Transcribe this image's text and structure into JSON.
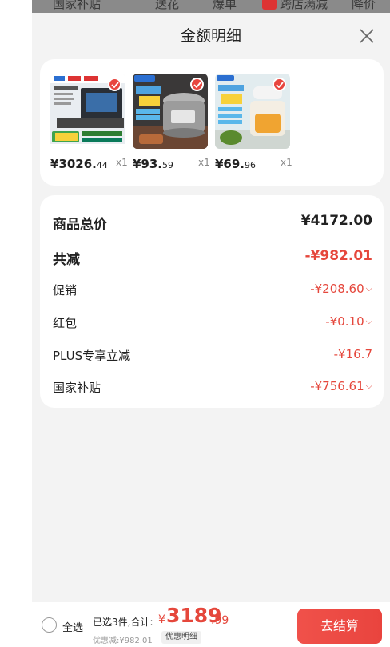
{
  "background_tabs": [
    "国家补贴",
    "送花",
    "爆单",
    "跨店满减",
    "降价"
  ],
  "sheet": {
    "title": "金额明细",
    "close_icon": "close-icon"
  },
  "products": [
    {
      "price_main": "¥3026.",
      "price_dec": "44",
      "qty": "x1",
      "image": "range-hood-image"
    },
    {
      "price_main": "¥93.",
      "price_dec": "59",
      "qty": "x1",
      "image": "electric-pressure-cooker-image"
    },
    {
      "price_main": "¥69.",
      "price_dec": "96",
      "qty": "x1",
      "image": "food-chopper-image"
    }
  ],
  "summary": {
    "total_label": "商品总价",
    "total_value": "¥4172.00",
    "reduce_label": "共减",
    "reduce_value": "-¥982.01",
    "lines": [
      {
        "label": "促销",
        "value": "-¥208.60",
        "expandable": true
      },
      {
        "label": "红包",
        "value": "-¥0.10",
        "expandable": true
      },
      {
        "label": "PLUS专享立减",
        "value": "-¥16.7",
        "expandable": false
      },
      {
        "label": "国家补贴",
        "value": "-¥756.61",
        "expandable": true
      }
    ]
  },
  "bottom_bar": {
    "select_all": "全选",
    "selected_text": "已选3件,合计:",
    "currency": "¥",
    "total_int": "3189",
    "total_dec": ".99",
    "discount_text": "优惠减:¥982.01",
    "detail_button": "优惠明细",
    "checkout_button": "去结算"
  },
  "colors": {
    "accent_red": "#e5473c",
    "sheet_bg": "#f3f3f3"
  }
}
